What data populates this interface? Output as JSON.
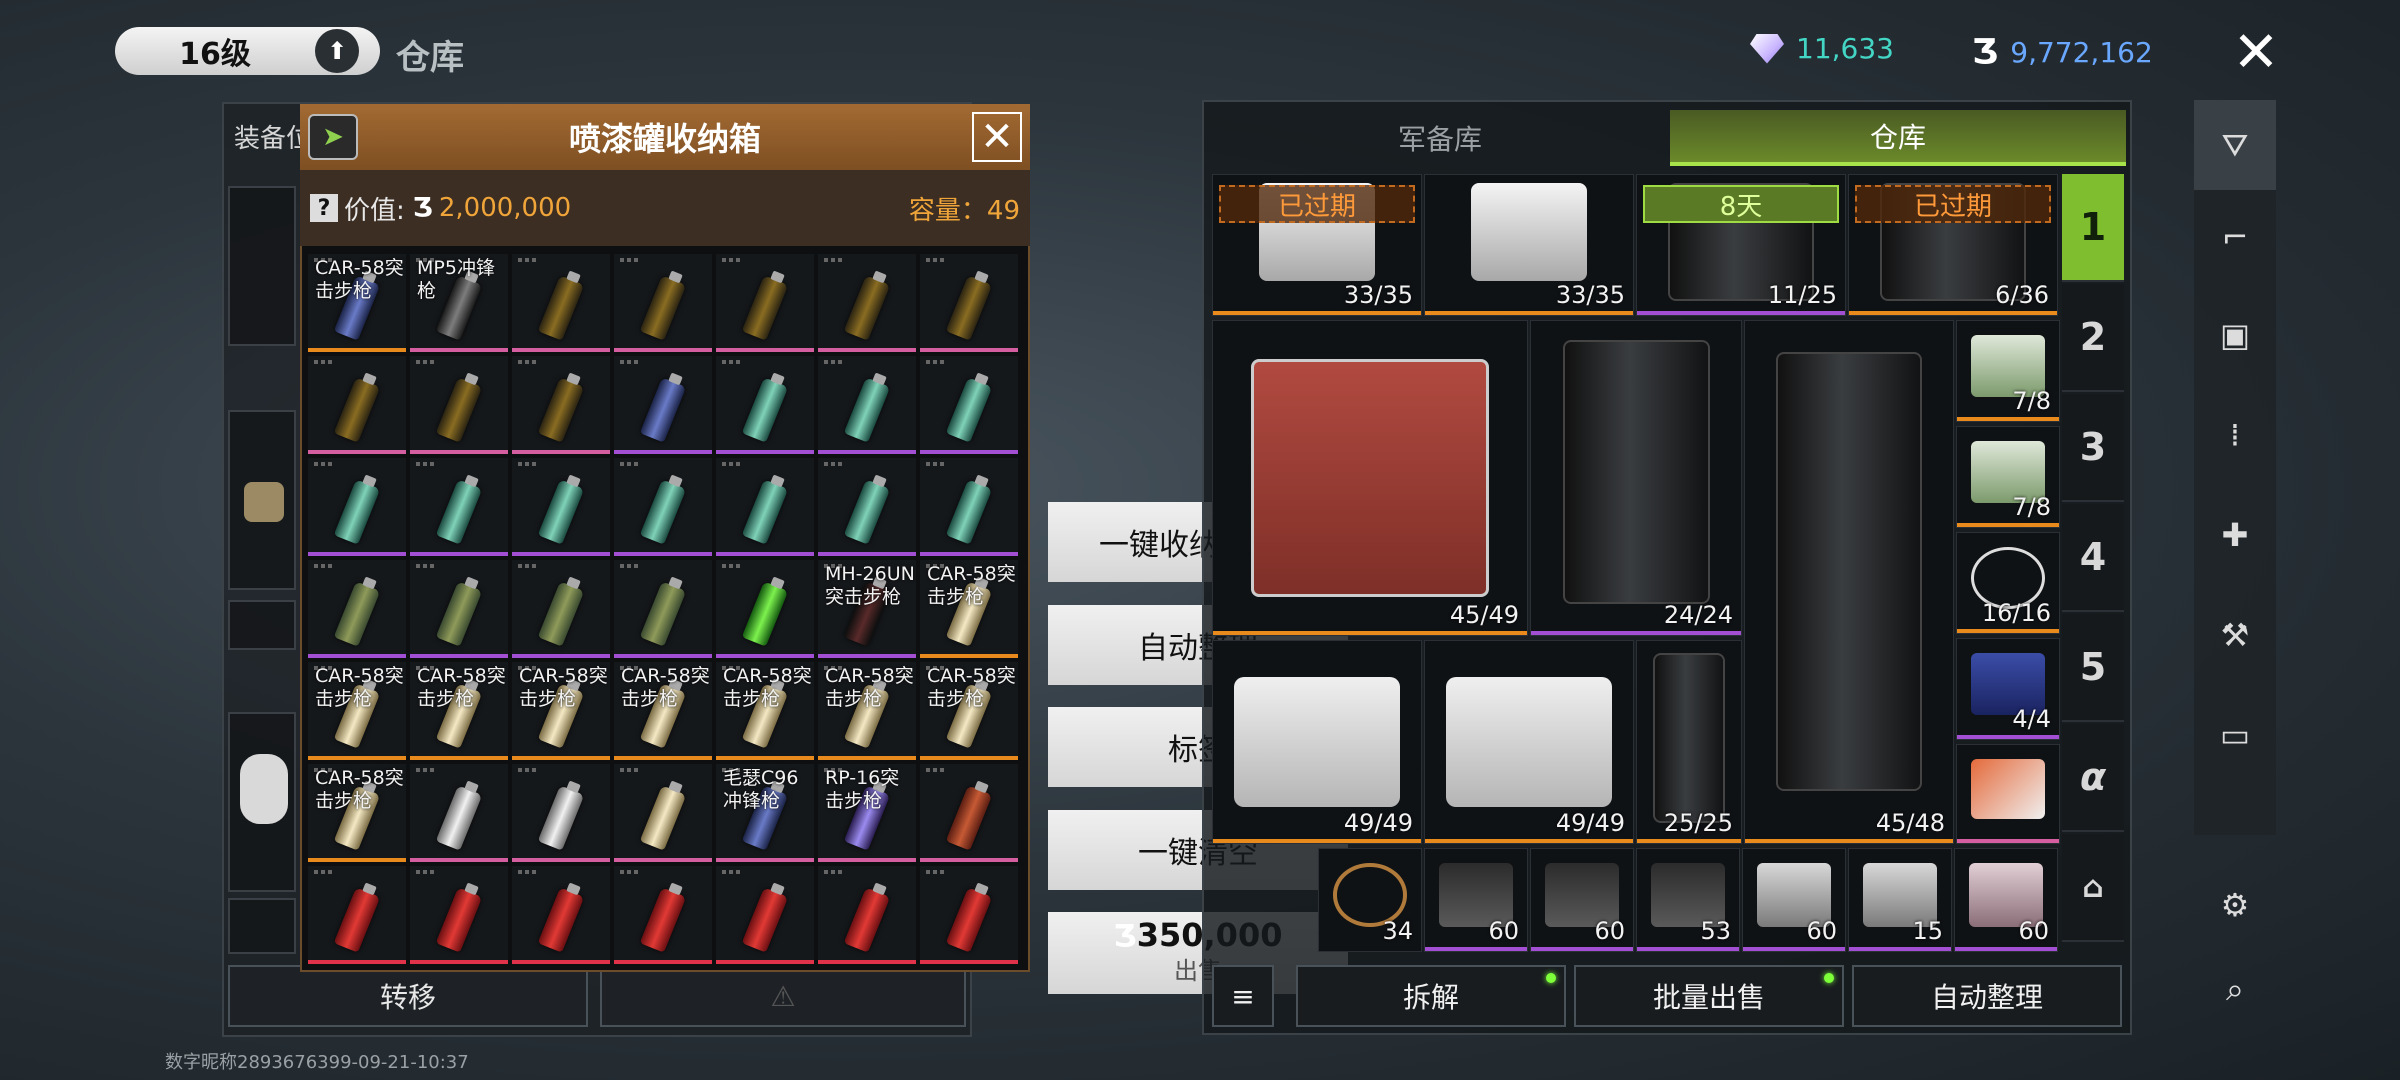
{
  "top": {
    "level": "16级",
    "title": "仓库",
    "gems": "11,633",
    "coins": "9,772,162",
    "gem_color": "#44d6c5",
    "coin_color": "#6aa8ff"
  },
  "left_panel": {
    "label": "装备位",
    "transfer_button": "转移",
    "footer": "数字昵称2893676399-09-21-10:37"
  },
  "popup": {
    "title": "喷漆罐收纳箱",
    "value_label": "价值:",
    "value": "2,000,000",
    "capacity": "容量：49",
    "cells": [
      {
        "label": "CAR-58突击步枪",
        "can": "navy",
        "rarity": "orange"
      },
      {
        "label": "MP5冲锋枪",
        "can": "dark",
        "rarity": "pink"
      },
      {
        "label": "",
        "can": "gold",
        "rarity": "pink"
      },
      {
        "label": "",
        "can": "gold",
        "rarity": "pink"
      },
      {
        "label": "",
        "can": "gold",
        "rarity": "pink"
      },
      {
        "label": "",
        "can": "gold",
        "rarity": "pink"
      },
      {
        "label": "",
        "can": "gold",
        "rarity": "pink"
      },
      {
        "label": "",
        "can": "gold",
        "rarity": "pink"
      },
      {
        "label": "",
        "can": "gold",
        "rarity": "pink"
      },
      {
        "label": "",
        "can": "gold",
        "rarity": "pink"
      },
      {
        "label": "",
        "can": "navy",
        "rarity": "purple"
      },
      {
        "label": "",
        "can": "teal",
        "rarity": "purple"
      },
      {
        "label": "",
        "can": "teal",
        "rarity": "purple"
      },
      {
        "label": "",
        "can": "teal",
        "rarity": "purple"
      },
      {
        "label": "",
        "can": "teal",
        "rarity": "purple"
      },
      {
        "label": "",
        "can": "teal",
        "rarity": "purple"
      },
      {
        "label": "",
        "can": "teal",
        "rarity": "purple"
      },
      {
        "label": "",
        "can": "teal",
        "rarity": "purple"
      },
      {
        "label": "",
        "can": "teal",
        "rarity": "purple"
      },
      {
        "label": "",
        "can": "teal",
        "rarity": "purple"
      },
      {
        "label": "",
        "can": "teal",
        "rarity": "purple"
      },
      {
        "label": "",
        "can": "camo",
        "rarity": "purple"
      },
      {
        "label": "",
        "can": "camo",
        "rarity": "purple"
      },
      {
        "label": "",
        "can": "camo",
        "rarity": "purple"
      },
      {
        "label": "",
        "can": "camo",
        "rarity": "purple"
      },
      {
        "label": "",
        "can": "green",
        "rarity": "purple"
      },
      {
        "label": "MH-26UN突击步枪",
        "can": "black",
        "rarity": "purple"
      },
      {
        "label": "CAR-58突击步枪",
        "can": "cream",
        "rarity": "orange"
      },
      {
        "label": "CAR-58突击步枪",
        "can": "cream",
        "rarity": "orange"
      },
      {
        "label": "CAR-58突击步枪",
        "can": "cream",
        "rarity": "orange"
      },
      {
        "label": "CAR-58突击步枪",
        "can": "cream",
        "rarity": "orange"
      },
      {
        "label": "CAR-58突击步枪",
        "can": "cream",
        "rarity": "orange"
      },
      {
        "label": "CAR-58突击步枪",
        "can": "cream",
        "rarity": "orange"
      },
      {
        "label": "CAR-58突击步枪",
        "can": "cream",
        "rarity": "orange"
      },
      {
        "label": "CAR-58突击步枪",
        "can": "cream",
        "rarity": "orange"
      },
      {
        "label": "CAR-58突击步枪",
        "can": "cream",
        "rarity": "orange"
      },
      {
        "label": "",
        "can": "silver",
        "rarity": "pink"
      },
      {
        "label": "",
        "can": "silver",
        "rarity": "pink"
      },
      {
        "label": "",
        "can": "cream",
        "rarity": "pink"
      },
      {
        "label": "毛瑟C96冲锋枪",
        "can": "navy",
        "rarity": "pink"
      },
      {
        "label": "RP-16突击步枪",
        "can": "purple",
        "rarity": "pink"
      },
      {
        "label": "",
        "can": "rust",
        "rarity": "pink"
      },
      {
        "label": "",
        "can": "red",
        "rarity": "red"
      },
      {
        "label": "",
        "can": "red",
        "rarity": "red"
      },
      {
        "label": "",
        "can": "red",
        "rarity": "red"
      },
      {
        "label": "",
        "can": "red",
        "rarity": "red"
      },
      {
        "label": "",
        "can": "red",
        "rarity": "red"
      },
      {
        "label": "",
        "can": "red",
        "rarity": "red"
      },
      {
        "label": "",
        "can": "red",
        "rarity": "red"
      }
    ]
  },
  "menu": {
    "one_click_store": "一键收纳",
    "auto_sort": "自动整理",
    "tags": "标签",
    "one_click_clear": "一键清空",
    "sell_price": "350,000",
    "sell_label": "出售"
  },
  "warehouse": {
    "tab_armory": "军备库",
    "tab_warehouse": "仓库",
    "expired": "已过期",
    "days": "8天",
    "counts": {
      "c1": "33/35",
      "c2": "33/35",
      "c3": "11/25",
      "c4": "6/36",
      "c5": "45/49",
      "c6": "24/24",
      "c7": "45/48",
      "c8": "7/8",
      "c9": "7/8",
      "c10": "16/16",
      "c11": "4/4",
      "c12": "49/49",
      "c13": "49/49",
      "c14": "25/25",
      "s1": "34",
      "s2": "60",
      "s3": "60",
      "s4": "53",
      "s5": "60",
      "s6": "15",
      "s7": "60"
    },
    "num_tabs": [
      "1",
      "2",
      "3",
      "4",
      "5",
      "α"
    ],
    "btn_dismantle": "拆解",
    "btn_bulk_sell": "批量出售",
    "btn_auto_sort": "自动整理"
  }
}
